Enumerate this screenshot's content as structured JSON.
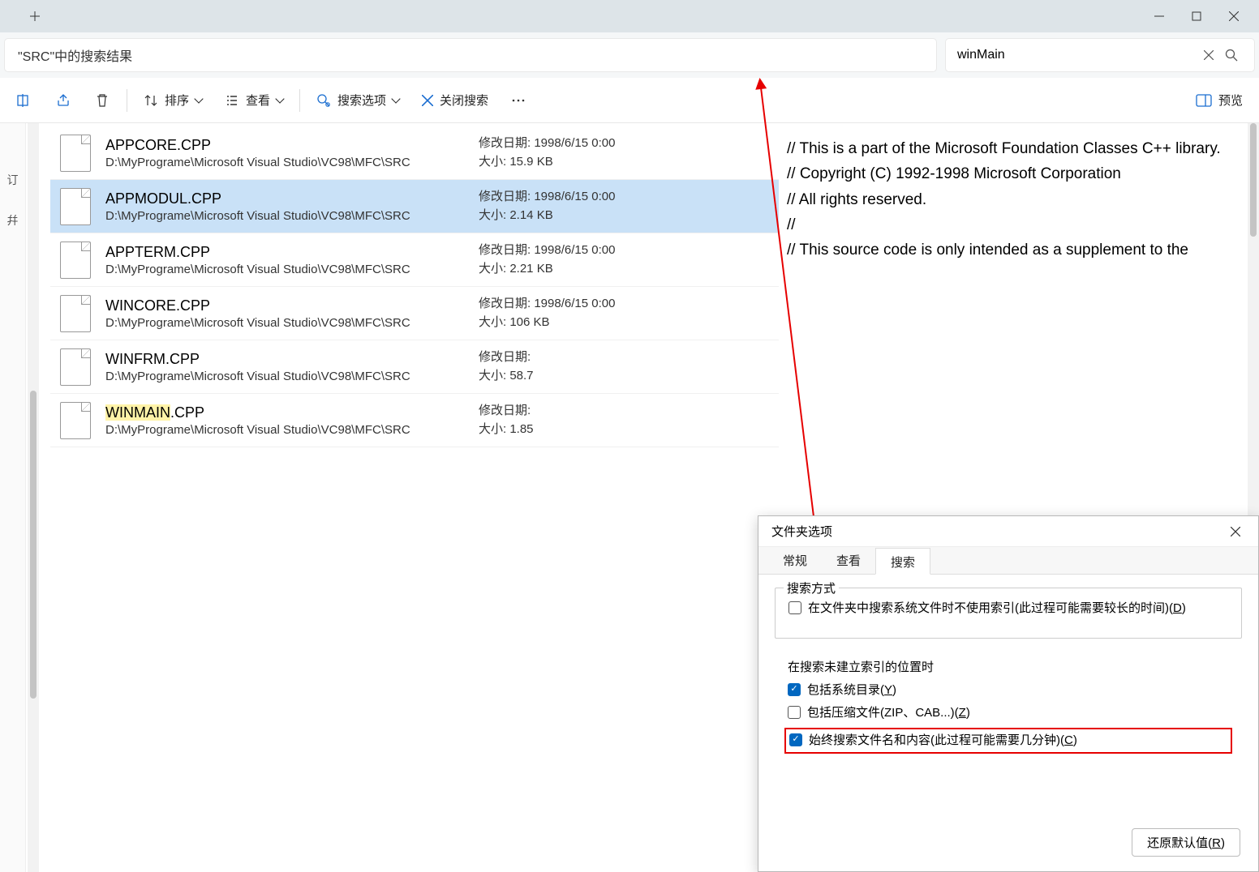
{
  "titlebar": {
    "newTab": "+"
  },
  "addressbar": {
    "text": "\"SRC\"中的搜索结果"
  },
  "search": {
    "value": "winMain"
  },
  "toolbar": {
    "sort": "排序",
    "view": "查看",
    "searchOptions": "搜索选项",
    "closeSearch": "关闭搜索",
    "preview": "预览"
  },
  "results": [
    {
      "name": "APPCORE.CPP",
      "path": "D:\\MyPrograme\\Microsoft Visual Studio\\VC98\\MFC\\SRC",
      "dateLabel": "修改日期:",
      "date": "1998/6/15 0:00",
      "sizeLabel": "大小:",
      "size": "15.9 KB",
      "selected": false,
      "highlight": ""
    },
    {
      "name": "APPMODUL.CPP",
      "path": "D:\\MyPrograme\\Microsoft Visual Studio\\VC98\\MFC\\SRC",
      "dateLabel": "修改日期:",
      "date": "1998/6/15 0:00",
      "sizeLabel": "大小:",
      "size": "2.14 KB",
      "selected": true,
      "highlight": ""
    },
    {
      "name": "APPTERM.CPP",
      "path": "D:\\MyPrograme\\Microsoft Visual Studio\\VC98\\MFC\\SRC",
      "dateLabel": "修改日期:",
      "date": "1998/6/15 0:00",
      "sizeLabel": "大小:",
      "size": "2.21 KB",
      "selected": false,
      "highlight": ""
    },
    {
      "name": "WINCORE.CPP",
      "path": "D:\\MyPrograme\\Microsoft Visual Studio\\VC98\\MFC\\SRC",
      "dateLabel": "修改日期:",
      "date": "1998/6/15 0:00",
      "sizeLabel": "大小:",
      "size": "106 KB",
      "selected": false,
      "highlight": ""
    },
    {
      "name": "WINFRM.CPP",
      "path": "D:\\MyPrograme\\Microsoft Visual Studio\\VC98\\MFC\\SRC",
      "dateLabel": "修改日期:",
      "date": "",
      "sizeLabel": "大小:",
      "size": "58.7",
      "selected": false,
      "highlight": ""
    },
    {
      "name": ".CPP",
      "prehl": "WINMAIN",
      "path": "D:\\MyPrograme\\Microsoft Visual Studio\\VC98\\MFC\\SRC",
      "dateLabel": "修改日期:",
      "date": "",
      "sizeLabel": "大小:",
      "size": "1.85",
      "selected": false,
      "highlight": "WINMAIN"
    }
  ],
  "preview": {
    "lines": [
      "// This is a part of the Microsoft Foundation Classes C++ library.",
      "// Copyright (C) 1992-1998 Microsoft Corporation",
      "// All rights reserved.",
      "//",
      "// This source code is only intended as a supplement to the"
    ]
  },
  "dialog": {
    "title": "文件夹选项",
    "tabs": {
      "general": "常规",
      "view": "查看",
      "search": "搜索"
    },
    "group1": {
      "title": "搜索方式",
      "opt1a": "在文件夹中搜索系统文件时不使用索引(此过程可能需要较长的时间)(",
      "opt1u": "D",
      "opt1b": ")"
    },
    "group2": {
      "title": "在搜索未建立索引的位置时",
      "optYa": "包括系统目录(",
      "optYu": "Y",
      "optYb": ")",
      "optZa": "包括压缩文件(ZIP、CAB...)(",
      "optZu": "Z",
      "optZb": ")",
      "optCa": "始终搜索文件名和内容(此过程可能需要几分钟)(",
      "optCu": "C",
      "optCb": ")"
    },
    "restoreA": "还原默认值(",
    "restoreU": "R",
    "restoreB": ")"
  },
  "sidebar": {
    "item1": "订",
    "item2": "幷"
  }
}
